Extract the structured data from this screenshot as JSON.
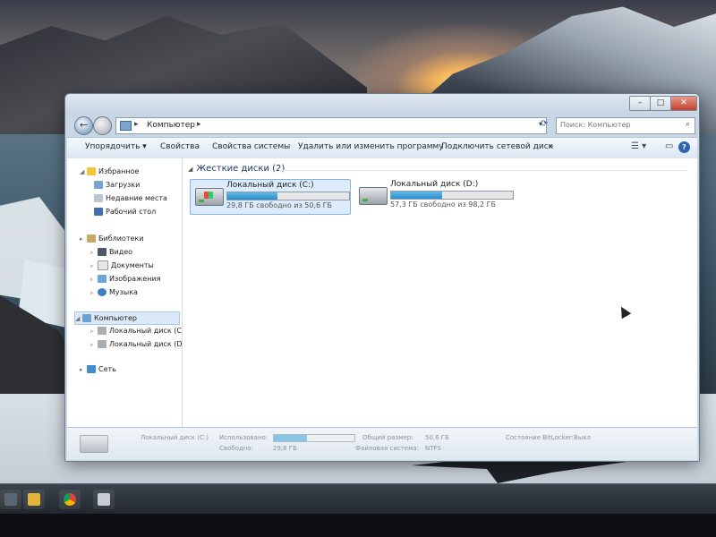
{
  "window": {
    "controls": {
      "minimize": "–",
      "maximize": "□",
      "close": "✕"
    }
  },
  "nav": {
    "back_icon": "←",
    "breadcrumb": "Компьютер",
    "search_placeholder": "Поиск: Компьютер"
  },
  "toolbar": {
    "organize": "Упорядочить ▾",
    "properties": "Свойства",
    "system_properties": "Свойства системы",
    "uninstall": "Удалить или изменить программу",
    "map_drive": "Подключить сетевой диск",
    "more": "»",
    "help": "?"
  },
  "sidebar": {
    "favorites": "Избранное",
    "downloads": "Загрузки",
    "recent": "Недавние места",
    "desktop": "Рабочий стол",
    "libraries": "Библиотеки",
    "video": "Видео",
    "documents": "Документы",
    "images": "Изображения",
    "music": "Музыка",
    "computer": "Компьютер",
    "drive_c": "Локальный диск (C",
    "drive_d": "Локальный диск (D",
    "network": "Сеть"
  },
  "main": {
    "group_title": "Жесткие диски (2)",
    "drives": [
      {
        "name": "Локальный диск (C:)",
        "free_text": "29,8 ГБ свободно из 50,6 ГБ",
        "used_fraction": 0.41
      },
      {
        "name": "Локальный диск (D:)",
        "free_text": "57,3 ГБ свободно из 98,2 ГБ",
        "used_fraction": 0.42
      }
    ]
  },
  "details": {
    "name": "Локальный диск (C:)",
    "used_label": "Использовано:",
    "free_label": "Свободно:",
    "free_value": "29,8 ГБ",
    "total_label": "Общий размер:",
    "total_value": "50,6 ГБ",
    "fs_label": "Файловая система:",
    "fs_value": "NTFS",
    "bitlocker_label": "Состояние BitLocker:",
    "bitlocker_value": "Выкл",
    "used_fraction": 0.41
  },
  "colors": {
    "bar_fill": "#2a8fcf",
    "selection": "#ddecfc"
  }
}
